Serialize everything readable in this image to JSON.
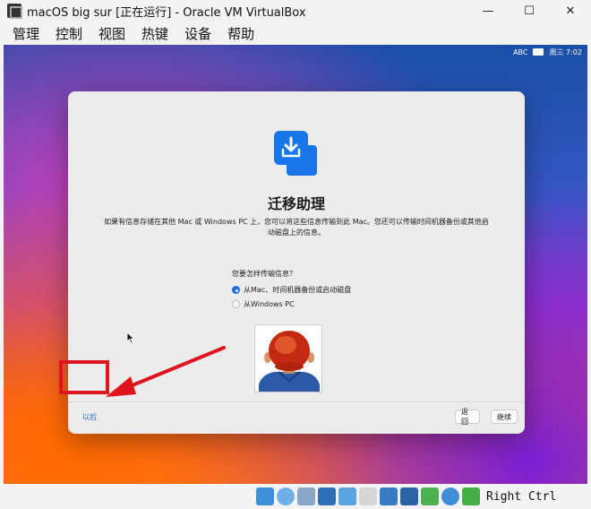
{
  "window": {
    "title": "macOS big sur [正在运行] - Oracle VM VirtualBox",
    "minimize": "—",
    "maximize": "☐",
    "close": "✕"
  },
  "menu": [
    "管理",
    "控制",
    "视图",
    "热键",
    "设备",
    "帮助"
  ],
  "mac_menubar": {
    "input": "ABC",
    "clock": "周三 7:02"
  },
  "dialog": {
    "title": "迁移助理",
    "description": "如果有信息存储在其他 Mac 或 Windows PC 上，您可以将这些信息传输到此 Mac。您还可以传输时间机器备份或其他启动磁盘上的信息。",
    "question": "您要怎样传输信息？",
    "options": [
      {
        "label": "从Mac、时间机器备份或启动磁盘",
        "selected": true
      },
      {
        "label": "从Windows PC",
        "selected": false
      }
    ],
    "later": "以后",
    "back": "返回",
    "continue": "继续"
  },
  "statusbar": {
    "icons": [
      "hdd-icon",
      "optical-disk-icon",
      "audio-icon",
      "network-icon",
      "usb-icon",
      "shared-folder-icon",
      "display-icon",
      "recording-icon",
      "cpu-icon",
      "mouse-integration-icon",
      "download-icon"
    ],
    "host_key": "Right Ctrl"
  },
  "colors": {
    "accent": "#1b6ee6",
    "annotation": "#e0141e"
  }
}
